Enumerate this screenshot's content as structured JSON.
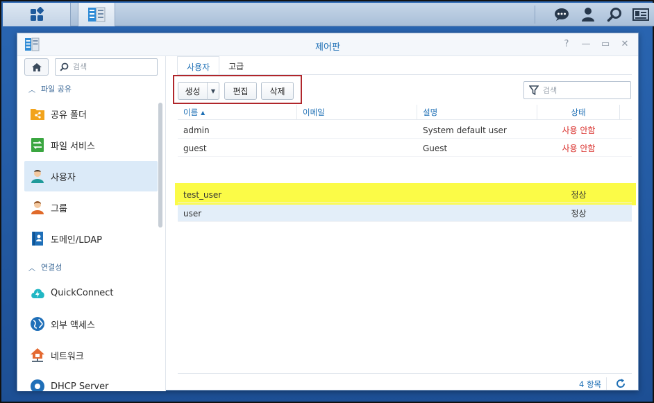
{
  "taskbar": {
    "main_menu_icon": "grid-icon",
    "app_icon": "control-panel-icon",
    "right_icons": [
      "chat-icon",
      "user-icon",
      "search-icon",
      "widget-icon"
    ]
  },
  "window": {
    "title": "제어판"
  },
  "sidebar": {
    "search_placeholder": "검색",
    "sections": [
      {
        "label": "파일 공유"
      },
      {
        "label": "연결성"
      }
    ],
    "items": [
      {
        "label": "공유 폴더",
        "icon": "shared-folder-icon"
      },
      {
        "label": "파일 서비스",
        "icon": "file-services-icon"
      },
      {
        "label": "사용자",
        "icon": "user-icon"
      },
      {
        "label": "그룹",
        "icon": "group-icon"
      },
      {
        "label": "도메인/LDAP",
        "icon": "domain-ldap-icon"
      },
      {
        "label": "QuickConnect",
        "icon": "quickconnect-icon"
      },
      {
        "label": "외부 액세스",
        "icon": "external-access-icon"
      },
      {
        "label": "네트워크",
        "icon": "network-icon"
      },
      {
        "label": "DHCP Server",
        "icon": "dhcp-server-icon"
      }
    ]
  },
  "tabs": [
    {
      "label": "사용자"
    },
    {
      "label": "고급"
    }
  ],
  "toolbar": {
    "create_label": "생성",
    "edit_label": "편집",
    "delete_label": "삭제",
    "filter_placeholder": "검색"
  },
  "grid": {
    "columns": [
      "이름",
      "이메일",
      "설명",
      "상태"
    ],
    "rows": [
      {
        "name": "admin",
        "email": "",
        "description": "System default user",
        "status": "사용 안함"
      },
      {
        "name": "guest",
        "email": "",
        "description": "Guest",
        "status": "사용 안함"
      },
      {
        "name": "test_user",
        "email": "",
        "description": "",
        "status": "정상"
      },
      {
        "name": "user",
        "email": "",
        "description": "",
        "status": "정상"
      }
    ]
  },
  "footer": {
    "count": "4 항목"
  },
  "colors": {
    "accent": "#1d6fb5",
    "disabled_status": "#d9302c",
    "highlight": "#fbfb47",
    "annotation_box": "#b0262b"
  }
}
